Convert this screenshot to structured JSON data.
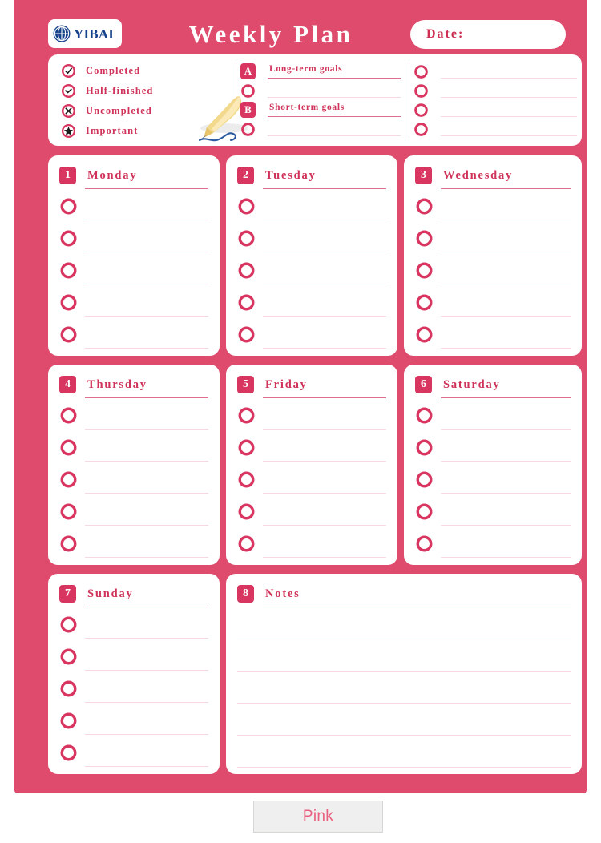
{
  "colors": {
    "sheet_pink": "#DE4B6D",
    "badge_pink": "#D83560",
    "text_pink": "#D0335A",
    "rule_strong": "#DE6F8E",
    "rule_faint": "#F6D9E0",
    "logo_blue": "#16428C",
    "swatch_text": "#E8607F",
    "swatch_bg": "#EFEFEF"
  },
  "header": {
    "logo_word": "YIBAI",
    "logo_icon": "yibai-globe-icon",
    "title": "Weekly Plan",
    "date_label": "Date:"
  },
  "legend": {
    "items": [
      {
        "icon": "check-circle-icon",
        "label": "Completed"
      },
      {
        "icon": "half-check-circle-icon",
        "label": "Half-finished"
      },
      {
        "icon": "cross-circle-icon",
        "label": "Uncompleted"
      },
      {
        "icon": "star-circle-icon",
        "label": "Important"
      }
    ],
    "decoration": "quill-pen-icon"
  },
  "goals": {
    "rows": [
      {
        "badge": "A",
        "kind": "badge",
        "label": "Long-term goals",
        "rule": "strong"
      },
      {
        "badge": "",
        "kind": "ring",
        "label": "",
        "rule": "faint"
      },
      {
        "badge": "B",
        "kind": "badge",
        "label": "Short-term goals",
        "rule": "strong"
      },
      {
        "badge": "",
        "kind": "ring",
        "label": "",
        "rule": "faint"
      }
    ]
  },
  "blank_column": {
    "rows": [
      {
        "icon": "ring-icon"
      },
      {
        "icon": "ring-icon"
      },
      {
        "icon": "ring-icon"
      },
      {
        "icon": "ring-icon"
      }
    ]
  },
  "days": [
    {
      "num": "1",
      "title": "Monday",
      "rows": 5
    },
    {
      "num": "2",
      "title": "Tuesday",
      "rows": 5
    },
    {
      "num": "3",
      "title": "Wednesday",
      "rows": 5
    },
    {
      "num": "4",
      "title": "Thursday",
      "rows": 5
    },
    {
      "num": "5",
      "title": "Friday",
      "rows": 5
    },
    {
      "num": "6",
      "title": "Saturday",
      "rows": 5
    },
    {
      "num": "7",
      "title": "Sunday",
      "rows": 5
    }
  ],
  "notes": {
    "num": "8",
    "title": "Notes",
    "rows": 6
  },
  "swatch": {
    "label": "Pink"
  }
}
